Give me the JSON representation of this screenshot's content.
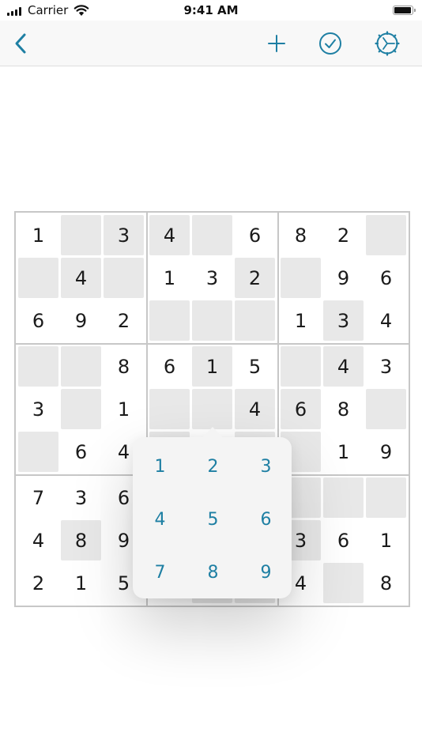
{
  "status_bar": {
    "carrier": "Carrier",
    "time": "9:41 AM"
  },
  "toolbar": {
    "back_icon": "chevron-left-icon",
    "add_icon": "plus-icon",
    "check_icon": "checkmark-circle-icon",
    "settings_icon": "gear-icon",
    "accent_color": "#1e7fa3"
  },
  "board": {
    "rows": [
      [
        "1",
        "",
        "3",
        "4",
        "",
        "6",
        "8",
        "2",
        ""
      ],
      [
        "",
        "4",
        "",
        "1",
        "3",
        "2",
        "",
        "9",
        "6"
      ],
      [
        "6",
        "9",
        "2",
        "",
        "",
        "",
        "1",
        "3",
        "4"
      ],
      [
        "",
        "",
        "8",
        "6",
        "1",
        "5",
        "",
        "4",
        "3"
      ],
      [
        "3",
        "",
        "1",
        "",
        "",
        "4",
        "6",
        "8",
        ""
      ],
      [
        "",
        "6",
        "4",
        "",
        "",
        "",
        "",
        "1",
        "9"
      ],
      [
        "7",
        "3",
        "6",
        "",
        "",
        "",
        "",
        "",
        ""
      ],
      [
        "4",
        "8",
        "9",
        "",
        "",
        "",
        "3",
        "6",
        "1"
      ],
      [
        "2",
        "1",
        "5",
        "",
        "",
        "",
        "4",
        "",
        "8"
      ]
    ],
    "shaded": [
      [
        0,
        1,
        1,
        1,
        1,
        0,
        0,
        0,
        1
      ],
      [
        1,
        1,
        1,
        0,
        0,
        1,
        1,
        0,
        0
      ],
      [
        0,
        0,
        0,
        1,
        1,
        1,
        0,
        1,
        0
      ],
      [
        1,
        1,
        0,
        0,
        1,
        0,
        1,
        1,
        0
      ],
      [
        0,
        1,
        0,
        1,
        1,
        1,
        1,
        0,
        1
      ],
      [
        1,
        0,
        0,
        1,
        0,
        1,
        1,
        0,
        0
      ],
      [
        0,
        0,
        0,
        0,
        0,
        0,
        1,
        1,
        1
      ],
      [
        0,
        1,
        0,
        0,
        0,
        0,
        1,
        0,
        0
      ],
      [
        0,
        0,
        0,
        0,
        1,
        1,
        0,
        1,
        0
      ]
    ]
  },
  "picker": {
    "numbers": [
      "1",
      "2",
      "3",
      "4",
      "5",
      "6",
      "7",
      "8",
      "9"
    ]
  }
}
